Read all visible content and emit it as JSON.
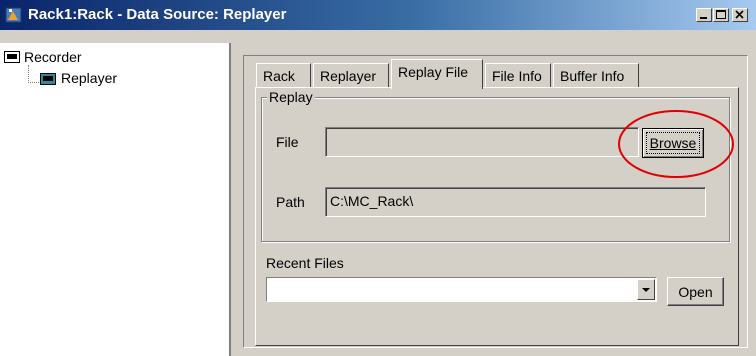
{
  "window": {
    "title": "Rack1:Rack - Data Source: Replayer"
  },
  "tree": {
    "items": [
      {
        "label": "Recorder"
      },
      {
        "label": "Replayer"
      }
    ]
  },
  "tabs": [
    {
      "label": "Rack"
    },
    {
      "label": "Replayer"
    },
    {
      "label": "Replay File"
    },
    {
      "label": "File Info"
    },
    {
      "label": "Buffer Info"
    }
  ],
  "replay": {
    "group_label": "Replay",
    "file_label": "File",
    "file_value": "",
    "browse_label": "Browse",
    "path_label": "Path",
    "path_value": "C:\\MC_Rack\\"
  },
  "recent": {
    "label": "Recent Files",
    "selected": "",
    "open_label": "Open"
  },
  "colors": {
    "titlebar_start": "#0a246a",
    "titlebar_end": "#a6caf0",
    "face": "#d4d0c8",
    "highlight_ellipse": "#e00000"
  }
}
